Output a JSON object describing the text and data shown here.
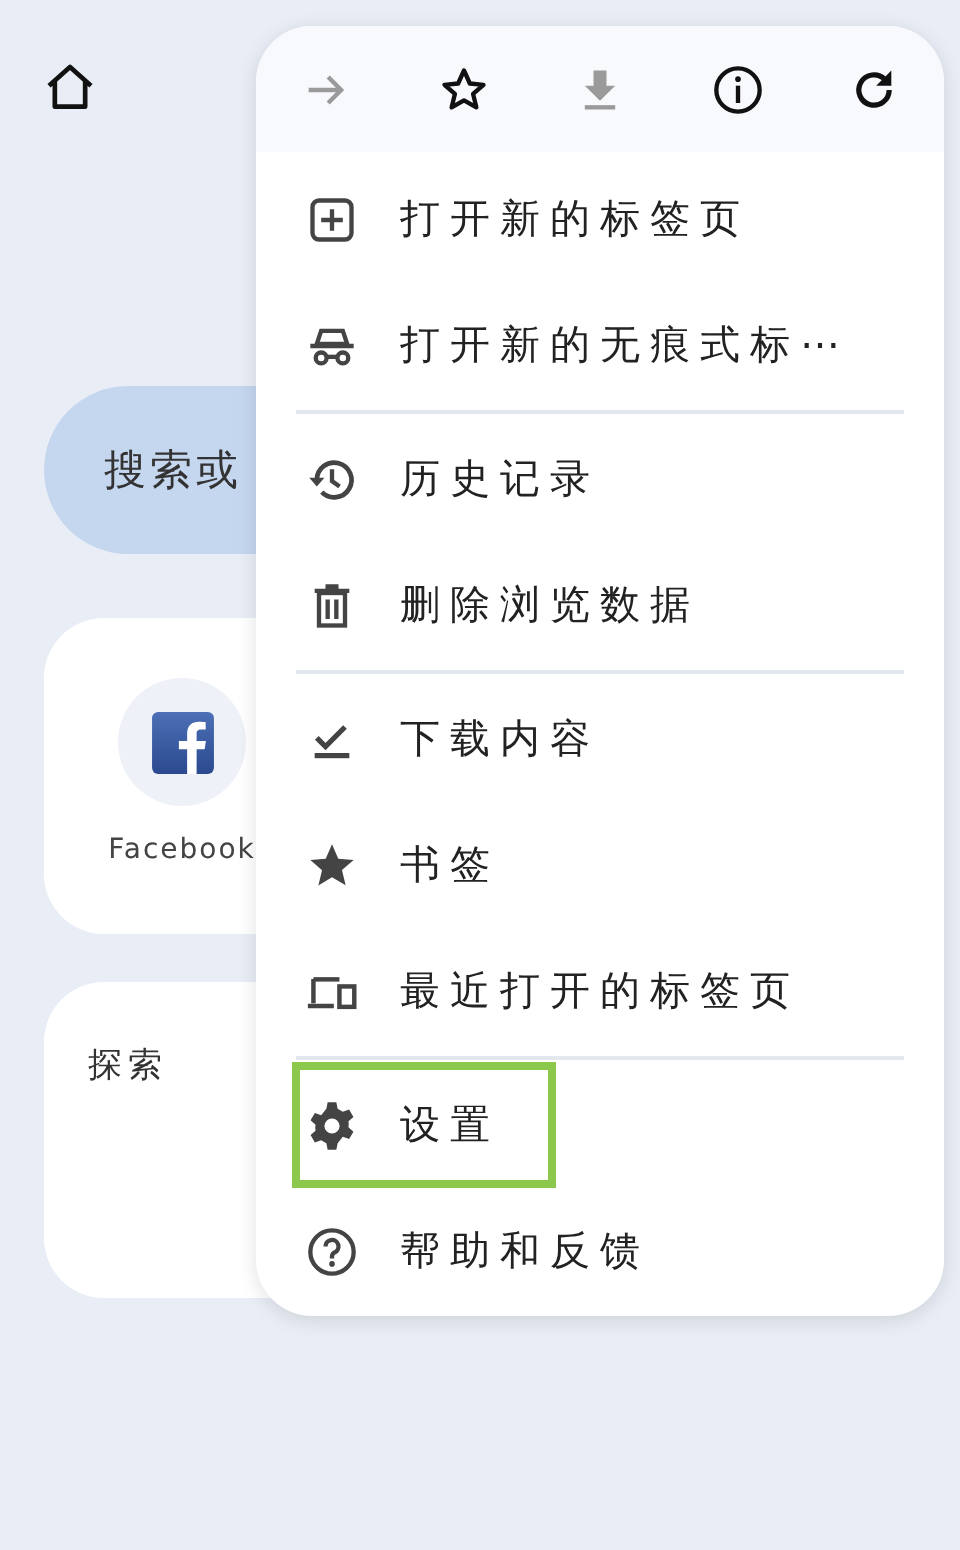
{
  "page": {
    "search": {
      "placeholder": "搜索或"
    },
    "shortcuts": [
      {
        "label": "Facebook"
      }
    ],
    "explore": {
      "title": "探索"
    }
  },
  "menu": {
    "toolbar": [
      {
        "kind": "forward",
        "disabled": true
      },
      {
        "kind": "star",
        "disabled": false
      },
      {
        "kind": "download",
        "disabled": true
      },
      {
        "kind": "info",
        "disabled": false
      },
      {
        "kind": "refresh",
        "disabled": false
      }
    ],
    "sections": [
      [
        {
          "kind": "new-tab",
          "label": "打开新的标签页",
          "highlighted": false
        },
        {
          "kind": "incognito",
          "label": "打开新的无痕式标⋯",
          "highlighted": false
        }
      ],
      [
        {
          "kind": "history",
          "label": "历史记录",
          "highlighted": false
        },
        {
          "kind": "delete",
          "label": "删除浏览数据",
          "highlighted": false
        }
      ],
      [
        {
          "kind": "downloads",
          "label": "下载内容",
          "highlighted": false
        },
        {
          "kind": "bookmarks",
          "label": "书签",
          "highlighted": false
        },
        {
          "kind": "recent-tabs",
          "label": "最近打开的标签页",
          "highlighted": false
        }
      ],
      [
        {
          "kind": "settings",
          "label": "设置",
          "highlighted": true
        },
        {
          "kind": "help",
          "label": "帮助和反馈",
          "highlighted": false
        }
      ]
    ]
  }
}
